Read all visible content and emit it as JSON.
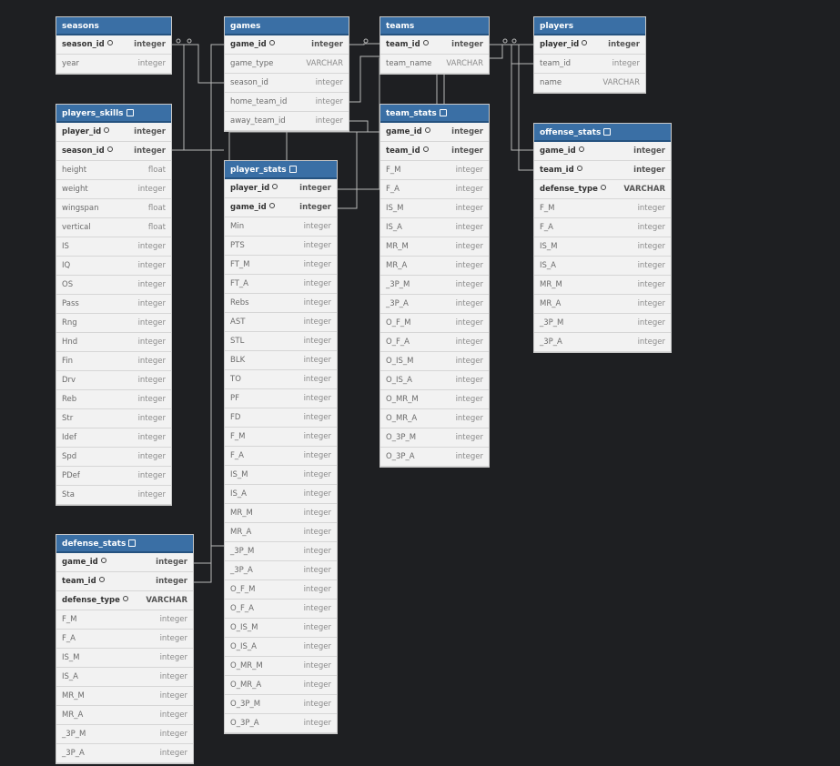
{
  "colors": {
    "background": "#1e1f22",
    "header": "#3a6fa5",
    "row": "#f2f2f2",
    "connector": "#b8b8b8"
  },
  "tables": [
    {
      "id": "seasons",
      "name": "seasons",
      "note": false,
      "columns": [
        {
          "name": "season_id",
          "type": "integer",
          "key": true,
          "icon": true
        },
        {
          "name": "year",
          "type": "integer",
          "key": false,
          "icon": false
        }
      ]
    },
    {
      "id": "games",
      "name": "games",
      "note": false,
      "columns": [
        {
          "name": "game_id",
          "type": "integer",
          "key": true,
          "icon": true
        },
        {
          "name": "game_type",
          "type": "VARCHAR",
          "key": false,
          "icon": false
        },
        {
          "name": "season_id",
          "type": "integer",
          "key": false,
          "icon": false
        },
        {
          "name": "home_team_id",
          "type": "integer",
          "key": false,
          "icon": false
        },
        {
          "name": "away_team_id",
          "type": "integer",
          "key": false,
          "icon": false
        }
      ]
    },
    {
      "id": "teams",
      "name": "teams",
      "note": false,
      "columns": [
        {
          "name": "team_id",
          "type": "integer",
          "key": true,
          "icon": true
        },
        {
          "name": "team_name",
          "type": "VARCHAR",
          "key": false,
          "icon": false
        }
      ]
    },
    {
      "id": "players",
      "name": "players",
      "note": false,
      "columns": [
        {
          "name": "player_id",
          "type": "integer",
          "key": true,
          "icon": true
        },
        {
          "name": "team_id",
          "type": "integer",
          "key": false,
          "icon": false
        },
        {
          "name": "name",
          "type": "VARCHAR",
          "key": false,
          "icon": false
        }
      ]
    },
    {
      "id": "players_skills",
      "name": "players_skills",
      "note": true,
      "columns": [
        {
          "name": "player_id",
          "type": "integer",
          "key": true,
          "icon": true
        },
        {
          "name": "season_id",
          "type": "integer",
          "key": true,
          "icon": true
        },
        {
          "name": "height",
          "type": "float",
          "key": false,
          "icon": false
        },
        {
          "name": "weight",
          "type": "integer",
          "key": false,
          "icon": false
        },
        {
          "name": "wingspan",
          "type": "float",
          "key": false,
          "icon": false
        },
        {
          "name": "vertical",
          "type": "float",
          "key": false,
          "icon": false
        },
        {
          "name": "IS",
          "type": "integer",
          "key": false,
          "icon": false
        },
        {
          "name": "IQ",
          "type": "integer",
          "key": false,
          "icon": false
        },
        {
          "name": "OS",
          "type": "integer",
          "key": false,
          "icon": false
        },
        {
          "name": "Pass",
          "type": "integer",
          "key": false,
          "icon": false
        },
        {
          "name": "Rng",
          "type": "integer",
          "key": false,
          "icon": false
        },
        {
          "name": "Hnd",
          "type": "integer",
          "key": false,
          "icon": false
        },
        {
          "name": "Fin",
          "type": "integer",
          "key": false,
          "icon": false
        },
        {
          "name": "Drv",
          "type": "integer",
          "key": false,
          "icon": false
        },
        {
          "name": "Reb",
          "type": "integer",
          "key": false,
          "icon": false
        },
        {
          "name": "Str",
          "type": "integer",
          "key": false,
          "icon": false
        },
        {
          "name": "Idef",
          "type": "integer",
          "key": false,
          "icon": false
        },
        {
          "name": "Spd",
          "type": "integer",
          "key": false,
          "icon": false
        },
        {
          "name": "PDef",
          "type": "integer",
          "key": false,
          "icon": false
        },
        {
          "name": "Sta",
          "type": "integer",
          "key": false,
          "icon": false
        }
      ]
    },
    {
      "id": "player_stats",
      "name": "player_stats",
      "note": true,
      "columns": [
        {
          "name": "player_id",
          "type": "integer",
          "key": true,
          "icon": true
        },
        {
          "name": "game_id",
          "type": "integer",
          "key": true,
          "icon": true
        },
        {
          "name": "Min",
          "type": "integer",
          "key": false,
          "icon": false
        },
        {
          "name": "PTS",
          "type": "integer",
          "key": false,
          "icon": false
        },
        {
          "name": "FT_M",
          "type": "integer",
          "key": false,
          "icon": false
        },
        {
          "name": "FT_A",
          "type": "integer",
          "key": false,
          "icon": false
        },
        {
          "name": "Rebs",
          "type": "integer",
          "key": false,
          "icon": false
        },
        {
          "name": "AST",
          "type": "integer",
          "key": false,
          "icon": false
        },
        {
          "name": "STL",
          "type": "integer",
          "key": false,
          "icon": false
        },
        {
          "name": "BLK",
          "type": "integer",
          "key": false,
          "icon": false
        },
        {
          "name": "TO",
          "type": "integer",
          "key": false,
          "icon": false
        },
        {
          "name": "PF",
          "type": "integer",
          "key": false,
          "icon": false
        },
        {
          "name": "FD",
          "type": "integer",
          "key": false,
          "icon": false
        },
        {
          "name": "F_M",
          "type": "integer",
          "key": false,
          "icon": false
        },
        {
          "name": "F_A",
          "type": "integer",
          "key": false,
          "icon": false
        },
        {
          "name": "IS_M",
          "type": "integer",
          "key": false,
          "icon": false
        },
        {
          "name": "IS_A",
          "type": "integer",
          "key": false,
          "icon": false
        },
        {
          "name": "MR_M",
          "type": "integer",
          "key": false,
          "icon": false
        },
        {
          "name": "MR_A",
          "type": "integer",
          "key": false,
          "icon": false
        },
        {
          "name": "_3P_M",
          "type": "integer",
          "key": false,
          "icon": false
        },
        {
          "name": "_3P_A",
          "type": "integer",
          "key": false,
          "icon": false
        },
        {
          "name": "O_F_M",
          "type": "integer",
          "key": false,
          "icon": false
        },
        {
          "name": "O_F_A",
          "type": "integer",
          "key": false,
          "icon": false
        },
        {
          "name": "O_IS_M",
          "type": "integer",
          "key": false,
          "icon": false
        },
        {
          "name": "O_IS_A",
          "type": "integer",
          "key": false,
          "icon": false
        },
        {
          "name": "O_MR_M",
          "type": "integer",
          "key": false,
          "icon": false
        },
        {
          "name": "O_MR_A",
          "type": "integer",
          "key": false,
          "icon": false
        },
        {
          "name": "O_3P_M",
          "type": "integer",
          "key": false,
          "icon": false
        },
        {
          "name": "O_3P_A",
          "type": "integer",
          "key": false,
          "icon": false
        }
      ]
    },
    {
      "id": "team_stats",
      "name": "team_stats",
      "note": true,
      "columns": [
        {
          "name": "game_id",
          "type": "integer",
          "key": true,
          "icon": true
        },
        {
          "name": "team_id",
          "type": "integer",
          "key": true,
          "icon": true
        },
        {
          "name": "F_M",
          "type": "integer",
          "key": false,
          "icon": false
        },
        {
          "name": "F_A",
          "type": "integer",
          "key": false,
          "icon": false
        },
        {
          "name": "IS_M",
          "type": "integer",
          "key": false,
          "icon": false
        },
        {
          "name": "IS_A",
          "type": "integer",
          "key": false,
          "icon": false
        },
        {
          "name": "MR_M",
          "type": "integer",
          "key": false,
          "icon": false
        },
        {
          "name": "MR_A",
          "type": "integer",
          "key": false,
          "icon": false
        },
        {
          "name": "_3P_M",
          "type": "integer",
          "key": false,
          "icon": false
        },
        {
          "name": "_3P_A",
          "type": "integer",
          "key": false,
          "icon": false
        },
        {
          "name": "O_F_M",
          "type": "integer",
          "key": false,
          "icon": false
        },
        {
          "name": "O_F_A",
          "type": "integer",
          "key": false,
          "icon": false
        },
        {
          "name": "O_IS_M",
          "type": "integer",
          "key": false,
          "icon": false
        },
        {
          "name": "O_IS_A",
          "type": "integer",
          "key": false,
          "icon": false
        },
        {
          "name": "O_MR_M",
          "type": "integer",
          "key": false,
          "icon": false
        },
        {
          "name": "O_MR_A",
          "type": "integer",
          "key": false,
          "icon": false
        },
        {
          "name": "O_3P_M",
          "type": "integer",
          "key": false,
          "icon": false
        },
        {
          "name": "O_3P_A",
          "type": "integer",
          "key": false,
          "icon": false
        }
      ]
    },
    {
      "id": "offense_stats",
      "name": "offense_stats",
      "note": true,
      "columns": [
        {
          "name": "game_id",
          "type": "integer",
          "key": true,
          "icon": true
        },
        {
          "name": "team_id",
          "type": "integer",
          "key": true,
          "icon": true
        },
        {
          "name": "defense_type",
          "type": "VARCHAR",
          "key": true,
          "icon": true
        },
        {
          "name": "F_M",
          "type": "integer",
          "key": false,
          "icon": false
        },
        {
          "name": "F_A",
          "type": "integer",
          "key": false,
          "icon": false
        },
        {
          "name": "IS_M",
          "type": "integer",
          "key": false,
          "icon": false
        },
        {
          "name": "IS_A",
          "type": "integer",
          "key": false,
          "icon": false
        },
        {
          "name": "MR_M",
          "type": "integer",
          "key": false,
          "icon": false
        },
        {
          "name": "MR_A",
          "type": "integer",
          "key": false,
          "icon": false
        },
        {
          "name": "_3P_M",
          "type": "integer",
          "key": false,
          "icon": false
        },
        {
          "name": "_3P_A",
          "type": "integer",
          "key": false,
          "icon": false
        }
      ]
    },
    {
      "id": "defense_stats",
      "name": "defense_stats",
      "note": true,
      "columns": [
        {
          "name": "game_id",
          "type": "integer",
          "key": true,
          "icon": true
        },
        {
          "name": "team_id",
          "type": "integer",
          "key": true,
          "icon": true
        },
        {
          "name": "defense_type",
          "type": "VARCHAR",
          "key": true,
          "icon": true
        },
        {
          "name": "F_M",
          "type": "integer",
          "key": false,
          "icon": false
        },
        {
          "name": "F_A",
          "type": "integer",
          "key": false,
          "icon": false
        },
        {
          "name": "IS_M",
          "type": "integer",
          "key": false,
          "icon": false
        },
        {
          "name": "IS_A",
          "type": "integer",
          "key": false,
          "icon": false
        },
        {
          "name": "MR_M",
          "type": "integer",
          "key": false,
          "icon": false
        },
        {
          "name": "MR_A",
          "type": "integer",
          "key": false,
          "icon": false
        },
        {
          "name": "_3P_M",
          "type": "integer",
          "key": false,
          "icon": false
        },
        {
          "name": "_3P_A",
          "type": "integer",
          "key": false,
          "icon": false
        }
      ]
    }
  ]
}
